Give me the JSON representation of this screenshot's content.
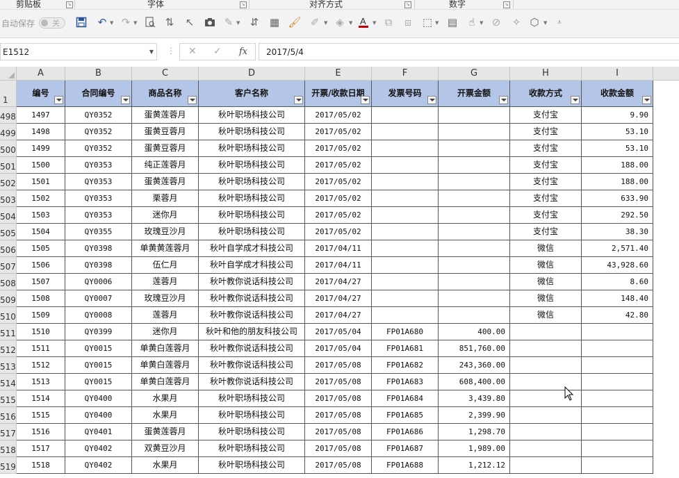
{
  "ribbon_groups": [
    {
      "id": "clipboard",
      "label": "剪贴板"
    },
    {
      "id": "font",
      "label": "字体"
    },
    {
      "id": "alignment",
      "label": "对齐方式"
    },
    {
      "id": "number",
      "label": "数字"
    }
  ],
  "qat": {
    "autosave_label": "自动保存",
    "autosave_state": "关",
    "icons": [
      "save-icon",
      "undo-icon",
      "redo-icon",
      "print-preview-icon",
      "sort-ascending-icon",
      "select-pointer-icon",
      "camera-icon",
      "brush-icon",
      "sort-descending-icon",
      "custom-sort-icon",
      "format-painter-icon",
      "draw-icon",
      "fill-color-icon",
      "font-color-icon",
      "shape-icon",
      "group-icon",
      "align-icon",
      "textbox-icon",
      "touch-mode-icon",
      "clear-filter-icon",
      "clean-icon",
      "more-icon",
      "customize-icon"
    ]
  },
  "formula_bar": {
    "name_box": "E1512",
    "cancel": "✕",
    "confirm": "✓",
    "fx": "fx",
    "content": "2017/5/4"
  },
  "columns": [
    "A",
    "B",
    "C",
    "D",
    "E",
    "F",
    "G",
    "H",
    "I"
  ],
  "header_row_number": "1",
  "headers": [
    "编号",
    "合同编号",
    "商品名称",
    "客户名称",
    "开票/收款日期",
    "发票号码",
    "开票金额",
    "收款方式",
    "收款金额"
  ],
  "rows": [
    {
      "rn": "498",
      "cells": [
        "1497",
        "QY0352",
        "蛋黄莲蓉月",
        "秋叶职场科技公司",
        "2017/05/02",
        "",
        "",
        "支付宝",
        "9.90"
      ]
    },
    {
      "rn": "499",
      "cells": [
        "1498",
        "QY0352",
        "蛋黄豆蓉月",
        "秋叶职场科技公司",
        "2017/05/02",
        "",
        "",
        "支付宝",
        "53.10"
      ]
    },
    {
      "rn": "500",
      "cells": [
        "1499",
        "QY0352",
        "蛋黄豆蓉月",
        "秋叶职场科技公司",
        "2017/05/02",
        "",
        "",
        "支付宝",
        "53.10"
      ]
    },
    {
      "rn": "501",
      "cells": [
        "1500",
        "QY0353",
        "纯正莲蓉月",
        "秋叶职场科技公司",
        "2017/05/02",
        "",
        "",
        "支付宝",
        "188.00"
      ]
    },
    {
      "rn": "502",
      "cells": [
        "1501",
        "QY0353",
        "蛋黄莲蓉月",
        "秋叶职场科技公司",
        "2017/05/02",
        "",
        "",
        "支付宝",
        "188.00"
      ]
    },
    {
      "rn": "503",
      "cells": [
        "1502",
        "QY0353",
        "栗蓉月",
        "秋叶职场科技公司",
        "2017/05/02",
        "",
        "",
        "支付宝",
        "633.90"
      ]
    },
    {
      "rn": "504",
      "cells": [
        "1503",
        "QY0353",
        "迷你月",
        "秋叶职场科技公司",
        "2017/05/02",
        "",
        "",
        "支付宝",
        "292.50"
      ]
    },
    {
      "rn": "505",
      "cells": [
        "1504",
        "QY0355",
        "玫瑰豆沙月",
        "秋叶职场科技公司",
        "2017/05/02",
        "",
        "",
        "支付宝",
        "38.30"
      ]
    },
    {
      "rn": "506",
      "cells": [
        "1505",
        "QY0398",
        "单黄黄莲蓉月",
        "秋叶自学成才科技公司",
        "2017/04/11",
        "",
        "",
        "微信",
        "2,571.40"
      ]
    },
    {
      "rn": "507",
      "cells": [
        "1506",
        "QY0398",
        "伍仁月",
        "秋叶自学成才科技公司",
        "2017/04/11",
        "",
        "",
        "微信",
        "43,928.60"
      ]
    },
    {
      "rn": "508",
      "cells": [
        "1507",
        "QY0006",
        "莲蓉月",
        "秋叶教你说话科技公司",
        "2017/04/27",
        "",
        "",
        "微信",
        "8.60"
      ]
    },
    {
      "rn": "509",
      "cells": [
        "1508",
        "QY0007",
        "玫瑰豆沙月",
        "秋叶教你说话科技公司",
        "2017/04/27",
        "",
        "",
        "微信",
        "148.40"
      ]
    },
    {
      "rn": "510",
      "cells": [
        "1509",
        "QY0008",
        "莲蓉月",
        "秋叶教你说话科技公司",
        "2017/04/27",
        "",
        "",
        "微信",
        "42.80"
      ]
    },
    {
      "rn": "511",
      "cells": [
        "1510",
        "QY0399",
        "迷你月",
        "秋叶和他的朋友科技公司",
        "2017/05/04",
        "FP01A680",
        "400.00",
        "",
        ""
      ]
    },
    {
      "rn": "512",
      "cells": [
        "1511",
        "QY0015",
        "单黄白莲蓉月",
        "秋叶教你说话科技公司",
        "2017/05/04",
        "FP01A681",
        "851,760.00",
        "",
        ""
      ]
    },
    {
      "rn": "513",
      "cells": [
        "1512",
        "QY0015",
        "单黄白莲蓉月",
        "秋叶教你说话科技公司",
        "2017/05/08",
        "FP01A682",
        "243,360.00",
        "",
        ""
      ]
    },
    {
      "rn": "514",
      "cells": [
        "1513",
        "QY0015",
        "单黄白莲蓉月",
        "秋叶教你说话科技公司",
        "2017/05/08",
        "FP01A683",
        "608,400.00",
        "",
        ""
      ]
    },
    {
      "rn": "515",
      "cells": [
        "1514",
        "QY0400",
        "水果月",
        "秋叶职场科技公司",
        "2017/05/08",
        "FP01A684",
        "3,439.80",
        "",
        ""
      ]
    },
    {
      "rn": "516",
      "cells": [
        "1515",
        "QY0400",
        "水果月",
        "秋叶职场科技公司",
        "2017/05/08",
        "FP01A685",
        "2,399.90",
        "",
        ""
      ]
    },
    {
      "rn": "517",
      "cells": [
        "1516",
        "QY0401",
        "蛋黄莲蓉月",
        "秋叶职场科技公司",
        "2017/05/08",
        "FP01A686",
        "1,298.70",
        "",
        ""
      ]
    },
    {
      "rn": "518",
      "cells": [
        "1517",
        "QY0402",
        "双黄豆沙月",
        "秋叶职场科技公司",
        "2017/05/08",
        "FP01A687",
        "1,989.00",
        "",
        ""
      ]
    },
    {
      "rn": "519",
      "cells": [
        "1518",
        "QY0402",
        "水果月",
        "秋叶职场科技公司",
        "2017/05/08",
        "FP01A688",
        "1,212.12",
        "",
        ""
      ]
    }
  ]
}
